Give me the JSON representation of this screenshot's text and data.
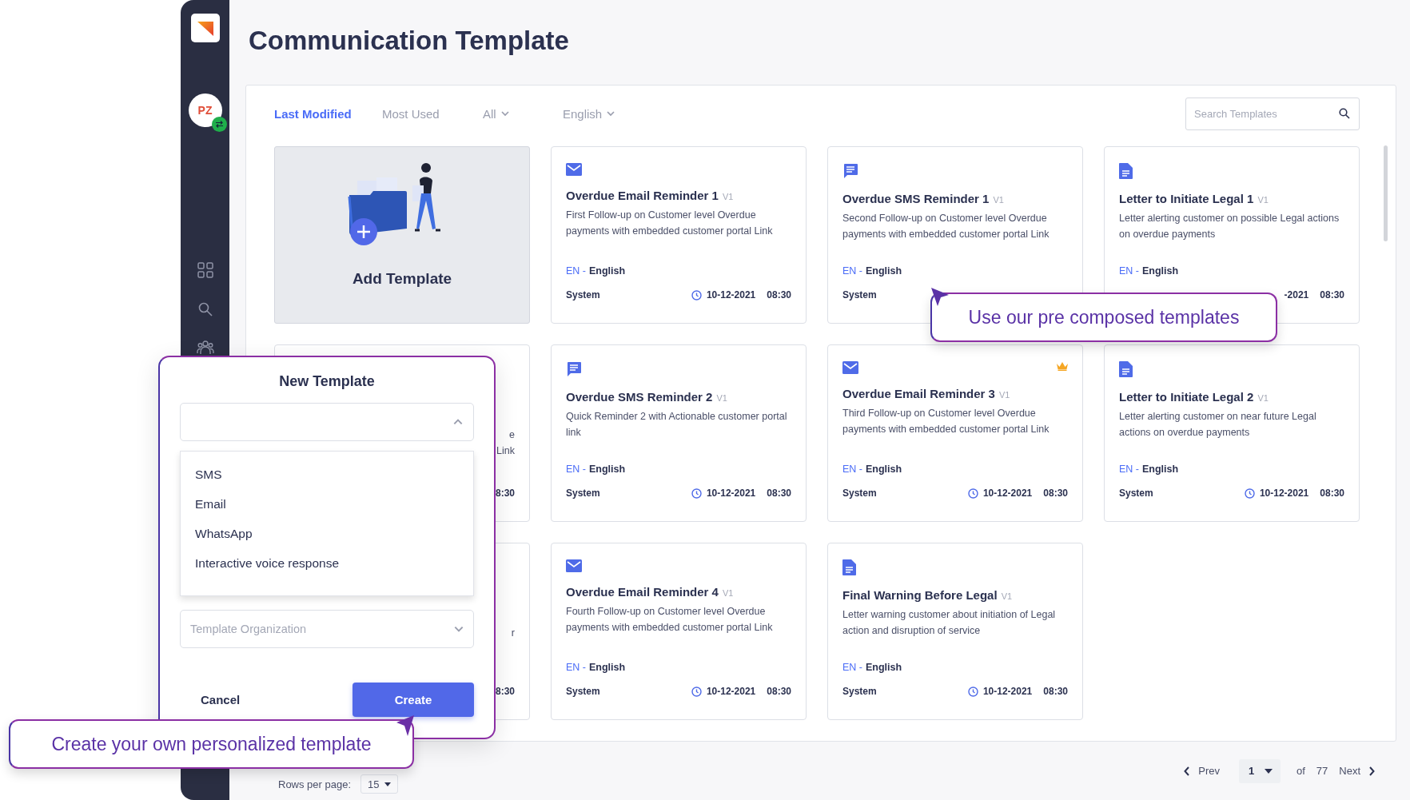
{
  "sidebar": {
    "avatar": "PZ"
  },
  "title": "Communication Template",
  "filters": [
    {
      "label": "Last Modified",
      "kind": "tab",
      "selected": true
    },
    {
      "label": "Most Used",
      "kind": "tab",
      "selected": false
    },
    {
      "label": "All",
      "kind": "dropdown",
      "selected": false
    },
    {
      "label": "English",
      "kind": "dropdown",
      "selected": false
    }
  ],
  "search": {
    "placeholder": "Search Templates"
  },
  "cards": [
    {
      "kind": "add",
      "label": "Add Template"
    },
    {
      "kind": "template",
      "icon": {
        "kind": "email"
      },
      "title": "Overdue Email Reminder 1",
      "version": "V1",
      "description": "First Follow-up on Customer level Overdue payments with embedded customer portal Link",
      "lang_code": "EN -",
      "language": "English",
      "author": "System",
      "date": "10-12-2021",
      "time": "08:30",
      "crowned": false
    },
    {
      "kind": "template",
      "icon": {
        "kind": "sms"
      },
      "title": "Overdue SMS Reminder 1",
      "version": "V1",
      "description": "Second Follow-up on Customer level Overdue payments with embedded customer portal Link",
      "lang_code": "EN -",
      "language": "English",
      "author": "System",
      "crowned": false
    },
    {
      "kind": "template",
      "icon": {
        "kind": "letter"
      },
      "title": "Letter to Initiate Legal 1",
      "version": "V1",
      "description": "Letter alerting customer on possible Legal actions on overdue payments",
      "lang_code": "EN -",
      "language": "English",
      "date": "-2021",
      "time": "08:30",
      "crowned": false
    },
    {
      "kind": "partial",
      "lines": [
        "e",
        "Link"
      ],
      "time": "8:30"
    },
    {
      "kind": "template",
      "icon": {
        "kind": "sms"
      },
      "title": "Overdue SMS Reminder 2",
      "version": "V1",
      "description": "Quick Reminder 2 with Actionable customer portal link",
      "lang_code": "EN -",
      "language": "English",
      "author": "System",
      "date": "10-12-2021",
      "time": "08:30",
      "crowned": false
    },
    {
      "kind": "template",
      "icon": {
        "kind": "email"
      },
      "title": "Overdue Email Reminder 3",
      "version": "V1",
      "description": "Third Follow-up on Customer level Overdue payments with embedded customer portal Link",
      "lang_code": "EN -",
      "language": "English",
      "author": "System",
      "date": "10-12-2021",
      "time": "08:30",
      "crowned": true
    },
    {
      "kind": "template",
      "icon": {
        "kind": "letter"
      },
      "title": "Letter to Initiate Legal 2",
      "version": "V1",
      "description": "Letter alerting customer on near future Legal actions on overdue payments",
      "lang_code": "EN -",
      "language": "English",
      "author": "System",
      "date": "10-12-2021",
      "time": "08:30",
      "crowned": false
    },
    {
      "kind": "partial",
      "lines": [
        "r"
      ],
      "time": "8:30"
    },
    {
      "kind": "template",
      "icon": {
        "kind": "email"
      },
      "title": "Overdue Email Reminder 4",
      "version": "V1",
      "description": "Fourth Follow-up on Customer level Overdue payments with embedded customer portal Link",
      "lang_code": "EN -",
      "language": "English",
      "author": "System",
      "date": "10-12-2021",
      "time": "08:30",
      "crowned": false
    },
    {
      "kind": "template",
      "icon": {
        "kind": "letter"
      },
      "title": "Final Warning Before Legal",
      "version": "V1",
      "description": "Letter warning customer about initiation of Legal action and disruption of service",
      "lang_code": "EN -",
      "language": "English",
      "author": "System",
      "date": "10-12-2021",
      "time": "08:30",
      "crowned": false
    }
  ],
  "pagination": {
    "rows_label": "Rows per page:",
    "rows_value": "15",
    "prev": "Prev",
    "page": "1",
    "of": "of",
    "total": "77",
    "next": "Next"
  },
  "modal": {
    "title": "New Template",
    "type_select": {
      "expanded": true
    },
    "options": [
      "SMS",
      "Email",
      "WhatsApp",
      "Interactive voice response"
    ],
    "org_select": {
      "placeholder": "Template Organization"
    },
    "cancel": "Cancel",
    "create": "Create"
  },
  "callouts": [
    {
      "text": "Use our pre composed templates"
    },
    {
      "text": "Create your own personalized template"
    }
  ]
}
